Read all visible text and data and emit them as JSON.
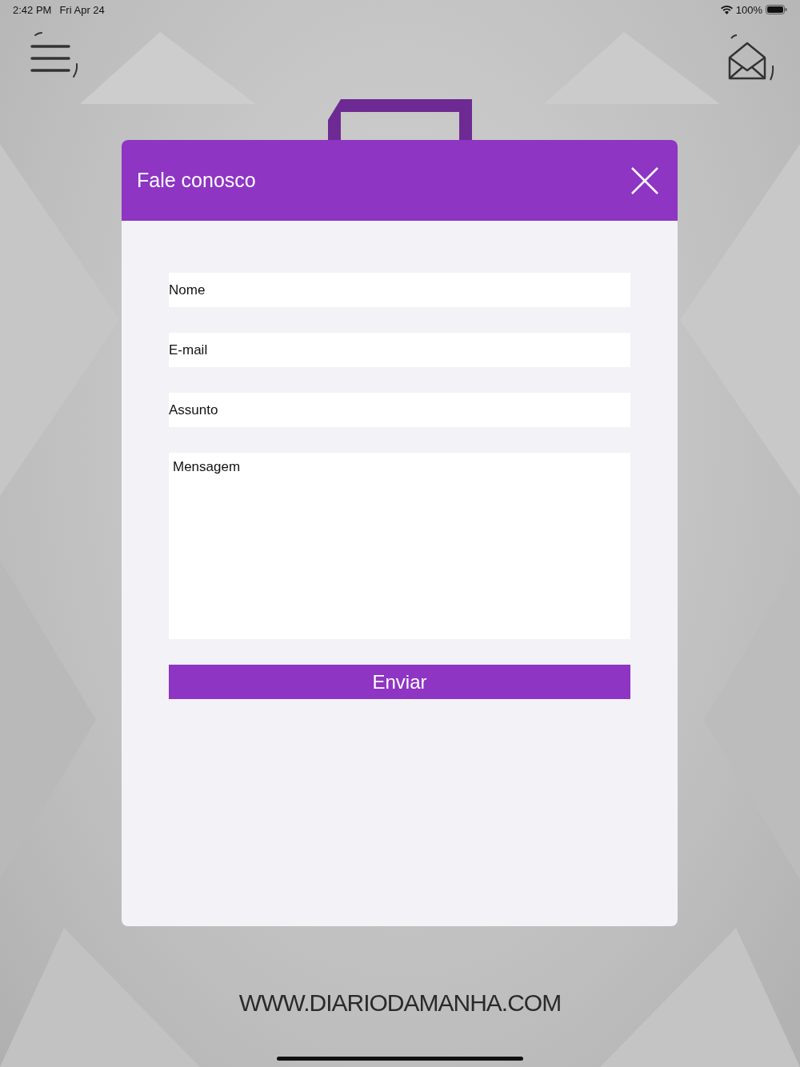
{
  "status_bar": {
    "time": "2:42 PM",
    "date": "Fri Apr 24",
    "battery": "100%"
  },
  "footer": {
    "url": "WWW.DIARIODAMANHA.COM"
  },
  "dialog": {
    "title": "Fale conosco",
    "fields": [
      {
        "placeholder": "Nome",
        "kind": "line"
      },
      {
        "placeholder": "E-mail",
        "kind": "line"
      },
      {
        "placeholder": "Assunto",
        "kind": "line"
      },
      {
        "placeholder": "Mensagem",
        "kind": "area"
      }
    ],
    "button": "Enviar"
  }
}
